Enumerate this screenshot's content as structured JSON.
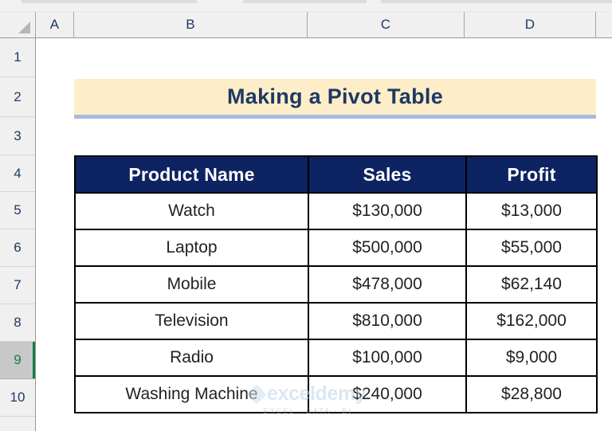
{
  "app": {
    "type": "spreadsheet",
    "select_all_corner": "select-all-triangle"
  },
  "grid": {
    "column_headers": [
      "A",
      "B",
      "C",
      "D"
    ],
    "row_headers": [
      "1",
      "2",
      "3",
      "4",
      "5",
      "6",
      "7",
      "8",
      "9",
      "10"
    ],
    "selected_row": "9"
  },
  "title": {
    "text": "Making a Pivot Table",
    "background_color": "#fdeec9",
    "text_color": "#1f3864",
    "underline_color": "#a8bbdd"
  },
  "table": {
    "header_background": "#0e2361",
    "header_text_color": "#ffffff",
    "border_color": "#000000",
    "columns": [
      "Product Name",
      "Sales",
      "Profit"
    ],
    "rows": [
      {
        "product": "Watch",
        "sales": "$130,000",
        "profit": "$13,000"
      },
      {
        "product": "Laptop",
        "sales": "$500,000",
        "profit": "$55,000"
      },
      {
        "product": "Mobile",
        "sales": "$478,000",
        "profit": "$62,140"
      },
      {
        "product": "Television",
        "sales": "$810,000",
        "profit": "$162,000"
      },
      {
        "product": "Radio",
        "sales": "$100,000",
        "profit": "$9,000"
      },
      {
        "product": "Washing Machine",
        "sales": "$240,000",
        "profit": "$28,800"
      }
    ]
  },
  "watermark": {
    "name": "exceldemy",
    "tagline": "EXCEL · DATA · BI"
  }
}
